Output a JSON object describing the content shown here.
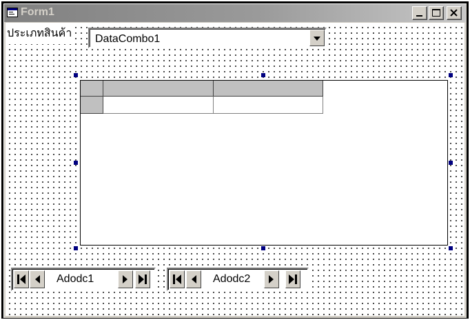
{
  "window": {
    "title": "Form1"
  },
  "controls": {
    "category_label": "ประเภทสินค้า",
    "combo": {
      "value": "DataCombo1"
    },
    "adodc1": {
      "caption": "Adodc1"
    },
    "adodc2": {
      "caption": "Adodc2"
    }
  },
  "icons": {
    "form": "form-icon",
    "minimize": "minimize-icon",
    "maximize": "maximize-icon",
    "close": "close-icon",
    "dropdown": "chevron-down-icon",
    "first": "move-first-icon",
    "prev": "move-previous-icon",
    "next": "move-next-icon",
    "last": "move-last-icon"
  },
  "colors": {
    "selection_handle": "#000080",
    "face": "#d4d0c8",
    "grid_header": "#c0c0c0"
  }
}
